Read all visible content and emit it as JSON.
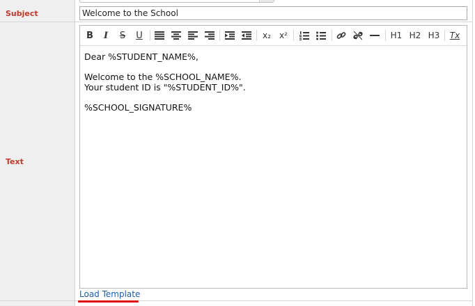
{
  "form": {
    "subject_label": "Subject",
    "subject_value": "Welcome to the School",
    "text_label": "Text"
  },
  "editor": {
    "toolbar": {
      "bold": "B",
      "italic": "I",
      "strike": "S",
      "underline": "U",
      "subscript": "x₂",
      "superscript": "x²",
      "h1": "H1",
      "h2": "H2",
      "h3": "H3",
      "clear": "Tx"
    },
    "content": {
      "line1": "Dear %STUDENT_NAME%,",
      "line2": "Welcome to the %SCHOOL_NAME%.",
      "line3": "Your student ID is \"%STUDENT_ID%\".",
      "line4": "%SCHOOL_SIGNATURE%"
    }
  },
  "load_template_label": "Load Template",
  "colors": {
    "label_red": "#c0392b",
    "link_blue": "#1a5ea8",
    "highlight_red": "#e01010"
  }
}
